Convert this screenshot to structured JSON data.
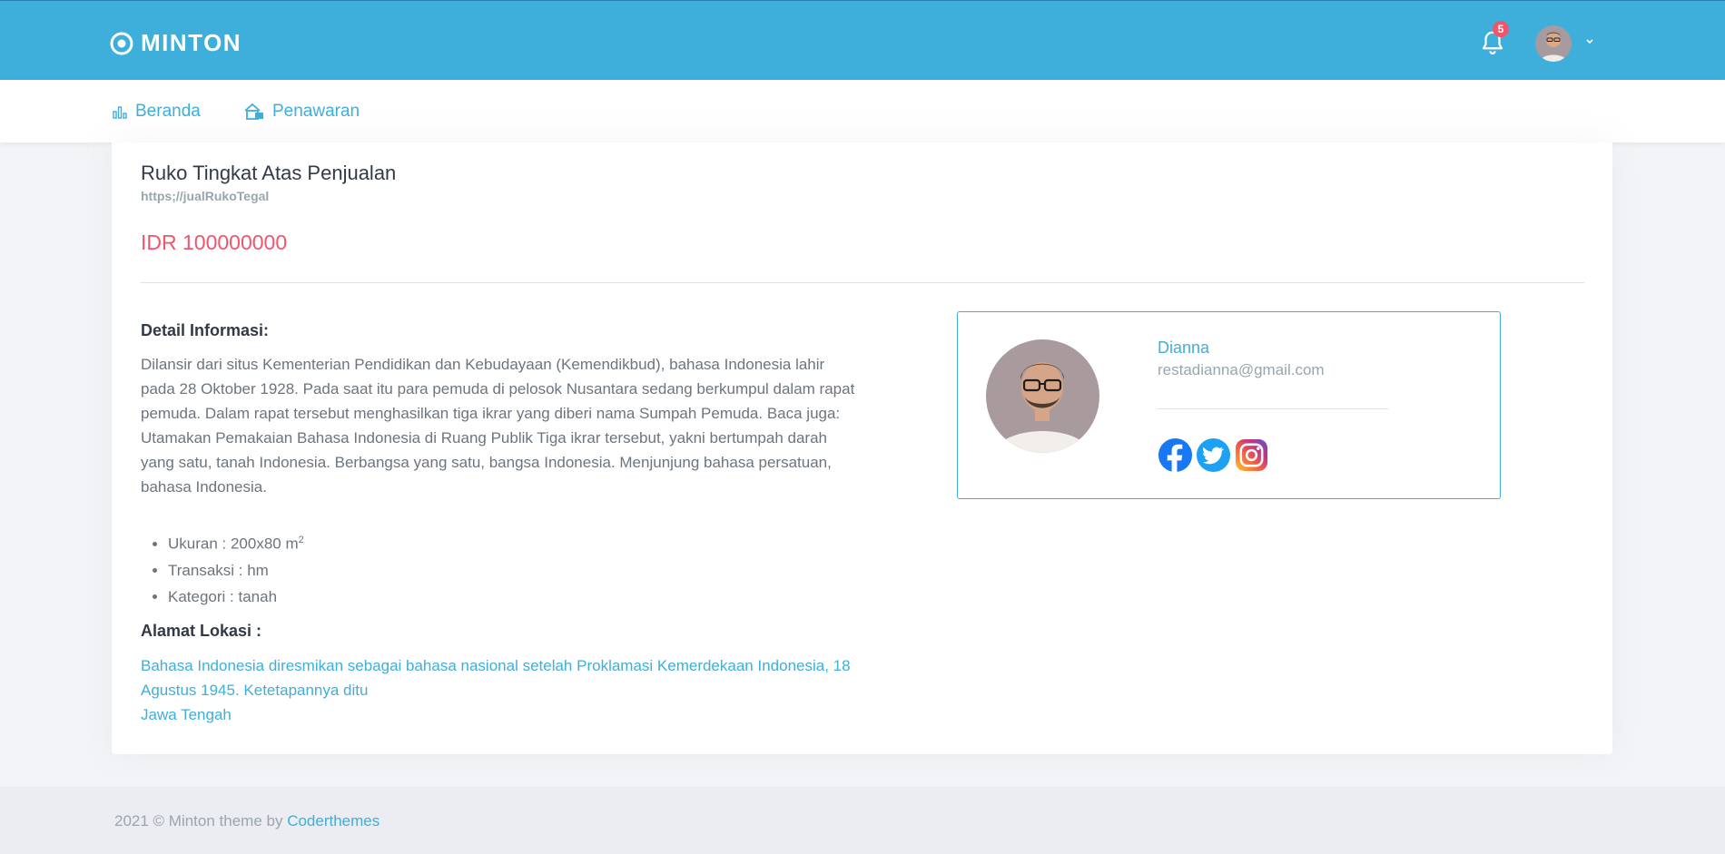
{
  "header": {
    "logo_text": "MINTON",
    "notification_count": "5"
  },
  "nav": {
    "items": [
      {
        "label": "Beranda",
        "icon": "bar-chart-icon"
      },
      {
        "label": "Penawaran",
        "icon": "house-icon"
      }
    ]
  },
  "listing": {
    "title": "Ruko Tingkat Atas Penjualan",
    "url": "https;//jualRukoTegal",
    "price": "IDR 100000000",
    "detail_heading": "Detail Informasi:",
    "description": "Dilansir dari situs Kementerian Pendidikan dan Kebudayaan (Kemendikbud), bahasa Indonesia lahir pada 28 Oktober 1928. Pada saat itu para pemuda di pelosok Nusantara sedang berkumpul dalam rapat pemuda. Dalam rapat tersebut menghasilkan tiga ikrar yang diberi nama Sumpah Pemuda. Baca juga: Utamakan Pemakaian Bahasa Indonesia di Ruang Publik Tiga ikrar tersebut, yakni bertumpah darah yang satu, tanah Indonesia. Berbangsa yang satu, bangsa Indonesia. Menjunjung bahasa persatuan, bahasa Indonesia.",
    "specs": {
      "size_label": "Ukuran : 200x80 m",
      "size_sup": "2",
      "transaction": "Transaksi : hm",
      "category": "Kategori : tanah"
    },
    "address_heading": "Alamat Lokasi :",
    "address_line1": "Bahasa Indonesia diresmikan sebagai bahasa nasional setelah Proklamasi Kemerdekaan Indonesia, 18 Agustus 1945. Ketetapannya ditu",
    "address_line2": "Jawa Tengah"
  },
  "agent": {
    "name": "Dianna",
    "email": "restadianna@gmail.com",
    "socials": [
      "facebook-icon",
      "twitter-icon",
      "instagram-icon"
    ]
  },
  "footer": {
    "text": "2021 © Minton theme by ",
    "link": "Coderthemes"
  },
  "colors": {
    "primary": "#3eaedb",
    "danger": "#f1556c",
    "footer_bg": "#ebedf2"
  }
}
